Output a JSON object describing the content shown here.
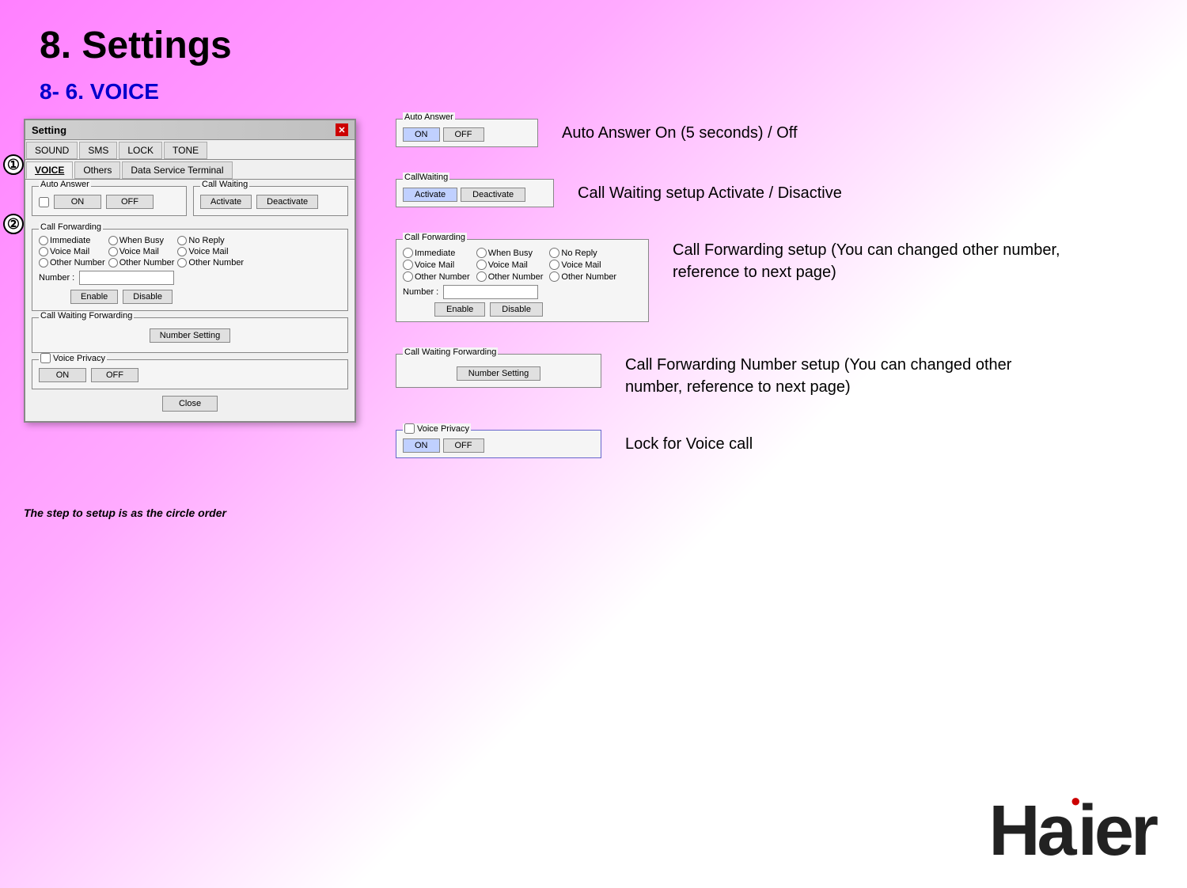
{
  "page": {
    "title": "8. Settings",
    "subtitle": "8- 6. VOICE"
  },
  "window": {
    "title": "Setting",
    "close": "×",
    "tabs_row1": [
      {
        "label": "SOUND",
        "active": false
      },
      {
        "label": "SMS",
        "active": false
      },
      {
        "label": "LOCK",
        "active": false
      },
      {
        "label": "TONE",
        "active": false
      }
    ],
    "tabs_row2": [
      {
        "label": "VOICE",
        "active": true
      },
      {
        "label": "Others",
        "active": false
      },
      {
        "label": "Data Service Terminal",
        "active": false
      }
    ],
    "auto_answer": {
      "label": "Auto Answer",
      "on": "ON",
      "off": "OFF"
    },
    "call_waiting": {
      "label": "Call Waiting",
      "activate": "Activate",
      "deactivate": "Deactivate"
    },
    "call_forwarding": {
      "label": "Call Forwarding",
      "col1": [
        "Immediate",
        "Voice Mail",
        "Other Number"
      ],
      "col2": [
        "When Busy",
        "Voice Mail",
        "Other Number"
      ],
      "col3": [
        "No Reply",
        "Voice Mail",
        "Other Number"
      ],
      "number_label": "Number :",
      "enable": "Enable",
      "disable": "Disable"
    },
    "call_waiting_forwarding": {
      "label": "Call Waiting  Forwarding",
      "number_setting": "Number Setting"
    },
    "voice_privacy": {
      "label": "Voice Privacy",
      "on": "ON",
      "off": "OFF"
    },
    "close_btn": "Close"
  },
  "circle_labels": [
    "①",
    "②"
  ],
  "step_text": "The step to setup is as the circle order",
  "explanations": [
    {
      "id": "auto-answer",
      "mini_label": "Auto Answer",
      "btn1": "ON",
      "btn2": "OFF",
      "text": "Auto Answer On (5 seconds) / Off"
    },
    {
      "id": "call-waiting",
      "mini_label": "CallWaiting",
      "btn1": "Activate",
      "btn2": "Deactivate",
      "text": "Call Waiting setup Activate / Disactive"
    },
    {
      "id": "call-forwarding",
      "mini_label": "Call Forwarding",
      "text1": "Call Forwarding setup (You can changed other number,",
      "text2": "reference to next page)"
    },
    {
      "id": "call-waiting-forwarding",
      "mini_label": "Call Waiting  Forwarding",
      "number_setting": "Number Setting",
      "text1": "Call Forwarding Number setup (You can changed other",
      "text2": "number, reference to next page)"
    },
    {
      "id": "voice-privacy",
      "mini_label": "Voice Privacy",
      "on": "ON",
      "off": "OFF",
      "text": "Lock for Voice call"
    }
  ],
  "fw_radio": {
    "col1": [
      "Immediate",
      "Voice Mail",
      "Other Number"
    ],
    "col2": [
      "When Busy",
      "Voice Mail",
      "Other Number"
    ],
    "col3": [
      "No Reply",
      "Voice Mail",
      "Other Number"
    ],
    "number_label": "Number :",
    "enable": "Enable",
    "disable": "Disable"
  },
  "haier": {
    "text": "Haier"
  }
}
